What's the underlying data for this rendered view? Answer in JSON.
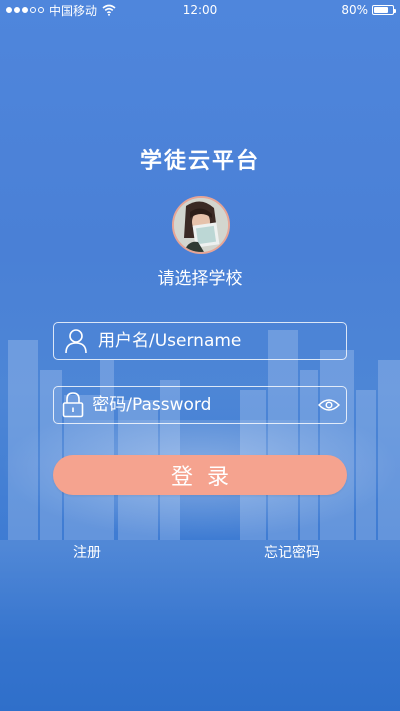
{
  "status_bar": {
    "carrier": "中国移动",
    "time": "12:00",
    "battery": "80%",
    "battery_level": 0.8,
    "signal_bars_filled": 3,
    "signal_bars_total": 5
  },
  "app_title": "学徒云平台",
  "select_school": "请选择学校",
  "username": {
    "placeholder": "用户名/Username",
    "icon": "user-icon"
  },
  "password": {
    "placeholder": "密码/Password",
    "icon": "lock-icon",
    "toggle_icon": "eye-icon"
  },
  "login_label": "登录",
  "register_label": "注册",
  "forgot_label": "忘记密码",
  "colors": {
    "background": "#4a80d6",
    "login_button": "#f5a38f",
    "avatar_border": "#e7a596"
  }
}
